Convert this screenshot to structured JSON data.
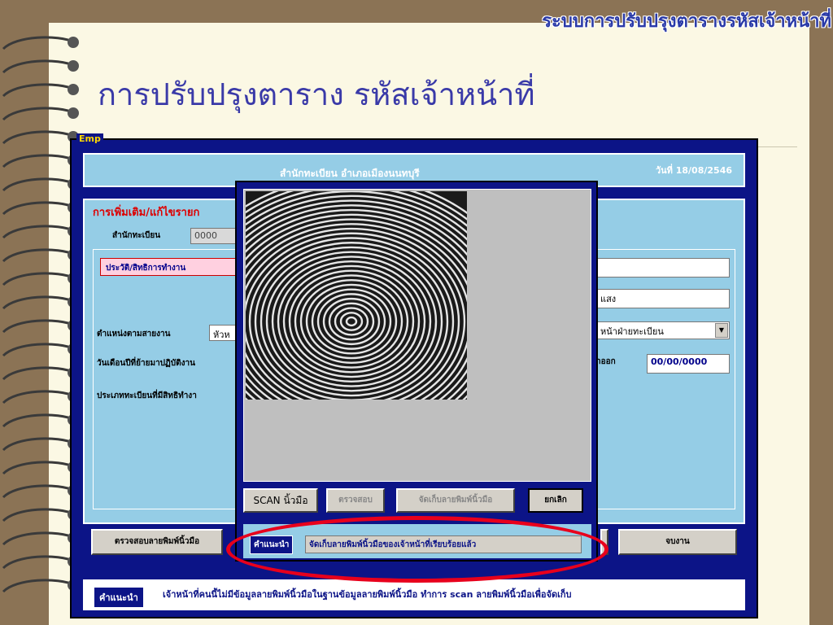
{
  "slide": {
    "header_title": "ระบบการปรับปรุงตารางรหัสเจ้าหน้าที่",
    "title": "การปรับปรุงตาราง รหัสเจ้าหน้าที่"
  },
  "window": {
    "label": "Emp",
    "office_name": "สำนักทะเบียน อำเภอเมืองนนทบุรี",
    "date": "วันที่ 18/08/2546",
    "section_title": "การเพิ่มเติม/แก้ไขรายก",
    "office_label": "สำนักทะเบียน",
    "office_code": "0000",
    "tab_label": "ประวัติ/สิทธิการทำงาน",
    "position_label": "ตำแหน่งตามสายงาน",
    "position_value": "หัวห",
    "move_date_label": "วันเดือนปีที่ย้ายมาปฏิบัติงาน",
    "reg_type_label": "ประเภททะเบียนที่มีสิทธิทำงา",
    "right_field2_value": "แสง",
    "right_dropdown_value": "หน้าฝ่ายทะเบียน",
    "exit_date_label": "าออก",
    "exit_date_value": "00/00/0000",
    "check_fp_button": "ตรวจสอบลายพิมพ์นิ้วมือ",
    "finish_button": "จบงาน",
    "hint_label": "คำแนะนำ",
    "hint_text": "เจ้าหน้าที่คนนี้ไม่มีข้อมูลลายพิมพ์นิ้วมือในฐานข้อมูลลายพิมพ์นิ้วมือ  ทำการ scan ลายพิมพ์นิ้วมือเพื่อจัดเก็บ"
  },
  "dialog": {
    "scan_button": "SCAN นิ้วมือ",
    "verify_button": "ตรวจสอบ",
    "save_button": "จัดเก็บลายพิมพ์นิ้วมือ",
    "cancel_button": "ยกเลิก",
    "hint_label": "คำแนะนำ",
    "hint_text": "จัดเก็บลายพิมพ์นิ้วมือของเจ้าหน้าที่เรียบร้อยแล้ว"
  },
  "colors": {
    "window_bg": "#0c1487",
    "panel_bg": "#95cde6",
    "highlight": "#e8001c"
  }
}
